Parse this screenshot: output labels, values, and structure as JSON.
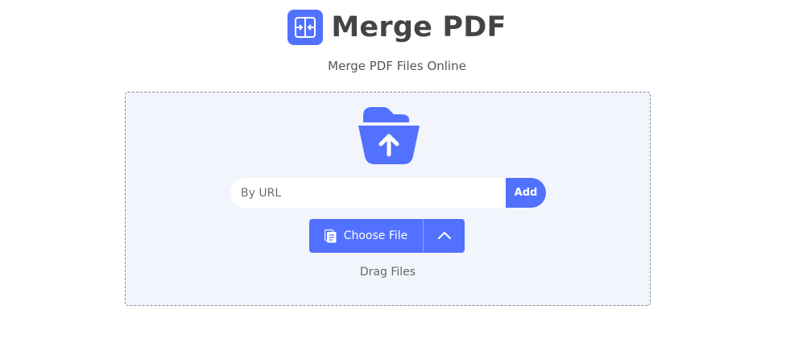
{
  "header": {
    "title": "Merge PDF",
    "subtitle": "Merge PDF Files Online",
    "logo_icon": "merge-pdf-icon"
  },
  "dropzone": {
    "upload_icon": "folder-upload-icon",
    "url_input": {
      "placeholder": "By URL",
      "value": ""
    },
    "add_label": "Add",
    "choose_file_label": "Choose File",
    "choose_file_icon": "document-icon",
    "toggle_icon": "chevron-up-icon",
    "drag_text": "Drag Files"
  },
  "colors": {
    "accent": "#5271ff",
    "dropzone_bg": "#f3f5fc",
    "title": "#444444"
  }
}
